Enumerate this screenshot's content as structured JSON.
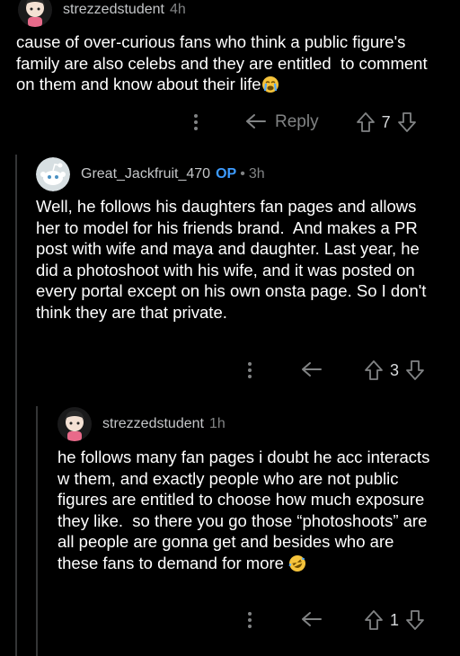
{
  "comments": [
    {
      "username": "strezzedstudent",
      "time": "4h",
      "body": "cause of over-curious fans who think a public figure's family are also celebs and they are entitled  to comment on them and know about their life",
      "reply_label": "Reply",
      "votes": "7",
      "avatar_icon": "anime-girl-avatar-icon",
      "emoji_icon": "crying-face-icon"
    },
    {
      "username": "Great_Jackfruit_470",
      "op_badge": "OP",
      "dot": "•",
      "time": "3h",
      "body": "Well, he follows his daughters fan pages and allows her to model for his friends brand.  And makes a PR post with wife and maya and daughter. Last year, he  did a photoshoot with his wife, and it was posted on every portal except on his own onsta page. So I don't think they are that private.",
      "votes": "3",
      "avatar_icon": "reddit-snoo-avatar-icon"
    },
    {
      "username": "strezzedstudent",
      "time": "1h",
      "body": "he follows many fan pages i doubt he acc interacts w them, and exactly people who are not public figures are entitled to choose how much exposure they like.  so there you go those “photoshoots” are all people are gonna get and besides who are these fans to demand for more",
      "votes": "1",
      "avatar_icon": "anime-girl-avatar-icon",
      "emoji_icon": "rolling-laughing-face-icon"
    }
  ],
  "colors": {
    "background": "#000000",
    "text": "#ffffff",
    "meta": "#818384",
    "op": "#3d9bff",
    "thread_line": "#343536"
  }
}
